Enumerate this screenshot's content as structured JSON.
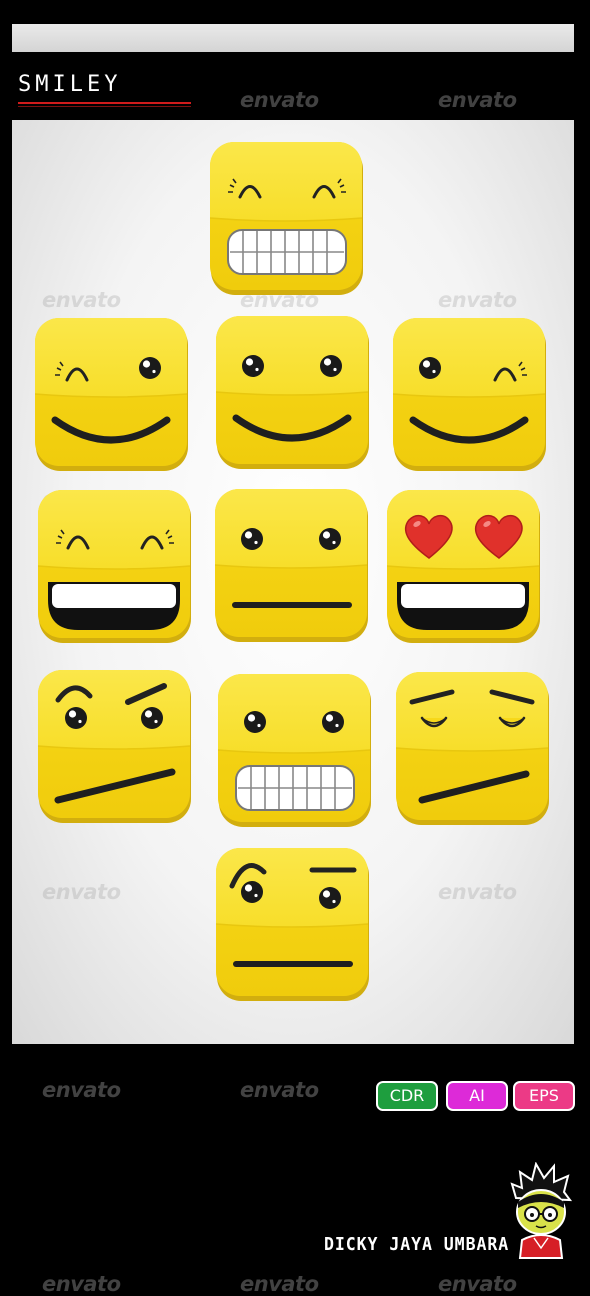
{
  "header": {
    "title": "SMILEY"
  },
  "watermark": {
    "text": "envato"
  },
  "formats": {
    "cdr": "CDR",
    "ai": "AI",
    "eps": "EPS"
  },
  "author": {
    "name": "DICKY JAYA UMBARA"
  },
  "colors": {
    "face": "#f5dc1e",
    "face_light": "#fbe94c",
    "rim": "#d7b40f",
    "panel": "#f3f3f3",
    "title_line": "#d01c1c",
    "cdr": "#1e9e3e",
    "ai": "#dd2ad8",
    "eps": "#ec3a86",
    "heart": "#e0312b"
  },
  "smileys": [
    {
      "name": "grin-closed-eyes"
    },
    {
      "name": "wink-smile-left"
    },
    {
      "name": "smile"
    },
    {
      "name": "wink-smile-right"
    },
    {
      "name": "laugh-closed-eyes"
    },
    {
      "name": "neutral"
    },
    {
      "name": "heart-eyes-laugh"
    },
    {
      "name": "skeptical"
    },
    {
      "name": "grin"
    },
    {
      "name": "unimpressed"
    },
    {
      "name": "raised-brow-neutral"
    }
  ]
}
